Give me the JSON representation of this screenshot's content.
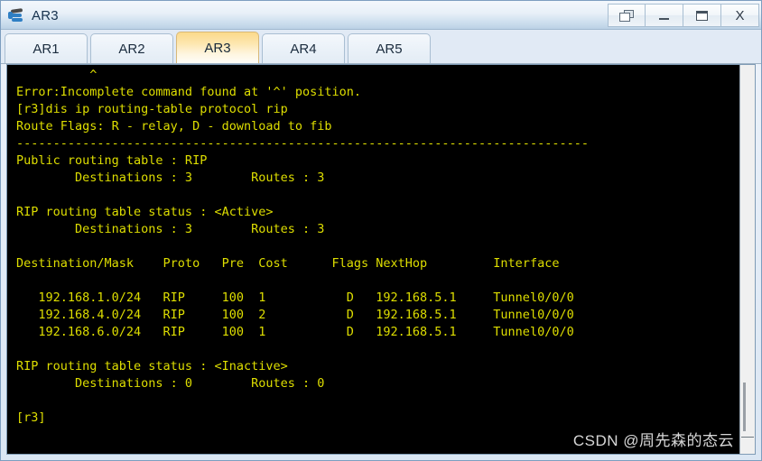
{
  "window": {
    "title": "AR3",
    "icon": "router-icon",
    "controls": [
      {
        "name": "restore-button",
        "label": "",
        "icon": "restore-icon"
      },
      {
        "name": "minimize-button",
        "label": "",
        "icon": "minimize-icon"
      },
      {
        "name": "maximize-button",
        "label": "",
        "icon": "maximize-icon"
      },
      {
        "name": "close-button",
        "label": "X",
        "icon": "close-icon"
      }
    ]
  },
  "tabs": {
    "items": [
      {
        "label": "AR1",
        "active": false
      },
      {
        "label": "AR2",
        "active": false
      },
      {
        "label": "AR3",
        "active": true
      },
      {
        "label": "AR4",
        "active": false
      },
      {
        "label": "AR5",
        "active": false
      }
    ],
    "active_label": "AR3"
  },
  "terminal": {
    "foreground_color": "#dede00",
    "background_color": "#000000",
    "lines": [
      "          ^",
      "Error:Incomplete command found at '^' position.",
      "[r3]dis ip routing-table protocol rip",
      "Route Flags: R - relay, D - download to fib",
      "------------------------------------------------------------------------------",
      "Public routing table : RIP",
      "        Destinations : 3        Routes : 3",
      "",
      "RIP routing table status : <Active>",
      "        Destinations : 3        Routes : 3",
      "",
      "Destination/Mask    Proto   Pre  Cost      Flags NextHop         Interface",
      "",
      "   192.168.1.0/24   RIP     100  1           D   192.168.5.1     Tunnel0/0/0",
      "   192.168.4.0/24   RIP     100  2           D   192.168.5.1     Tunnel0/0/0",
      "   192.168.6.0/24   RIP     100  1           D   192.168.5.1     Tunnel0/0/0",
      "",
      "RIP routing table status : <Inactive>",
      "        Destinations : 0        Routes : 0",
      "",
      "[r3]"
    ],
    "routing_table": {
      "headers": [
        "Destination/Mask",
        "Proto",
        "Pre",
        "Cost",
        "Flags",
        "NextHop",
        "Interface"
      ],
      "rows": [
        [
          "192.168.1.0/24",
          "RIP",
          "100",
          "1",
          "D",
          "192.168.5.1",
          "Tunnel0/0/0"
        ],
        [
          "192.168.4.0/24",
          "RIP",
          "100",
          "2",
          "D",
          "192.168.5.1",
          "Tunnel0/0/0"
        ],
        [
          "192.168.6.0/24",
          "RIP",
          "100",
          "1",
          "D",
          "192.168.5.1",
          "Tunnel0/0/0"
        ]
      ]
    },
    "summary": {
      "public_table": "RIP",
      "public_destinations": "3",
      "public_routes": "3",
      "active_destinations": "3",
      "active_routes": "3",
      "inactive_destinations": "0",
      "inactive_routes": "0"
    },
    "prompt": "[r3]"
  },
  "watermark": {
    "text": "CSDN @周先森的态云"
  }
}
